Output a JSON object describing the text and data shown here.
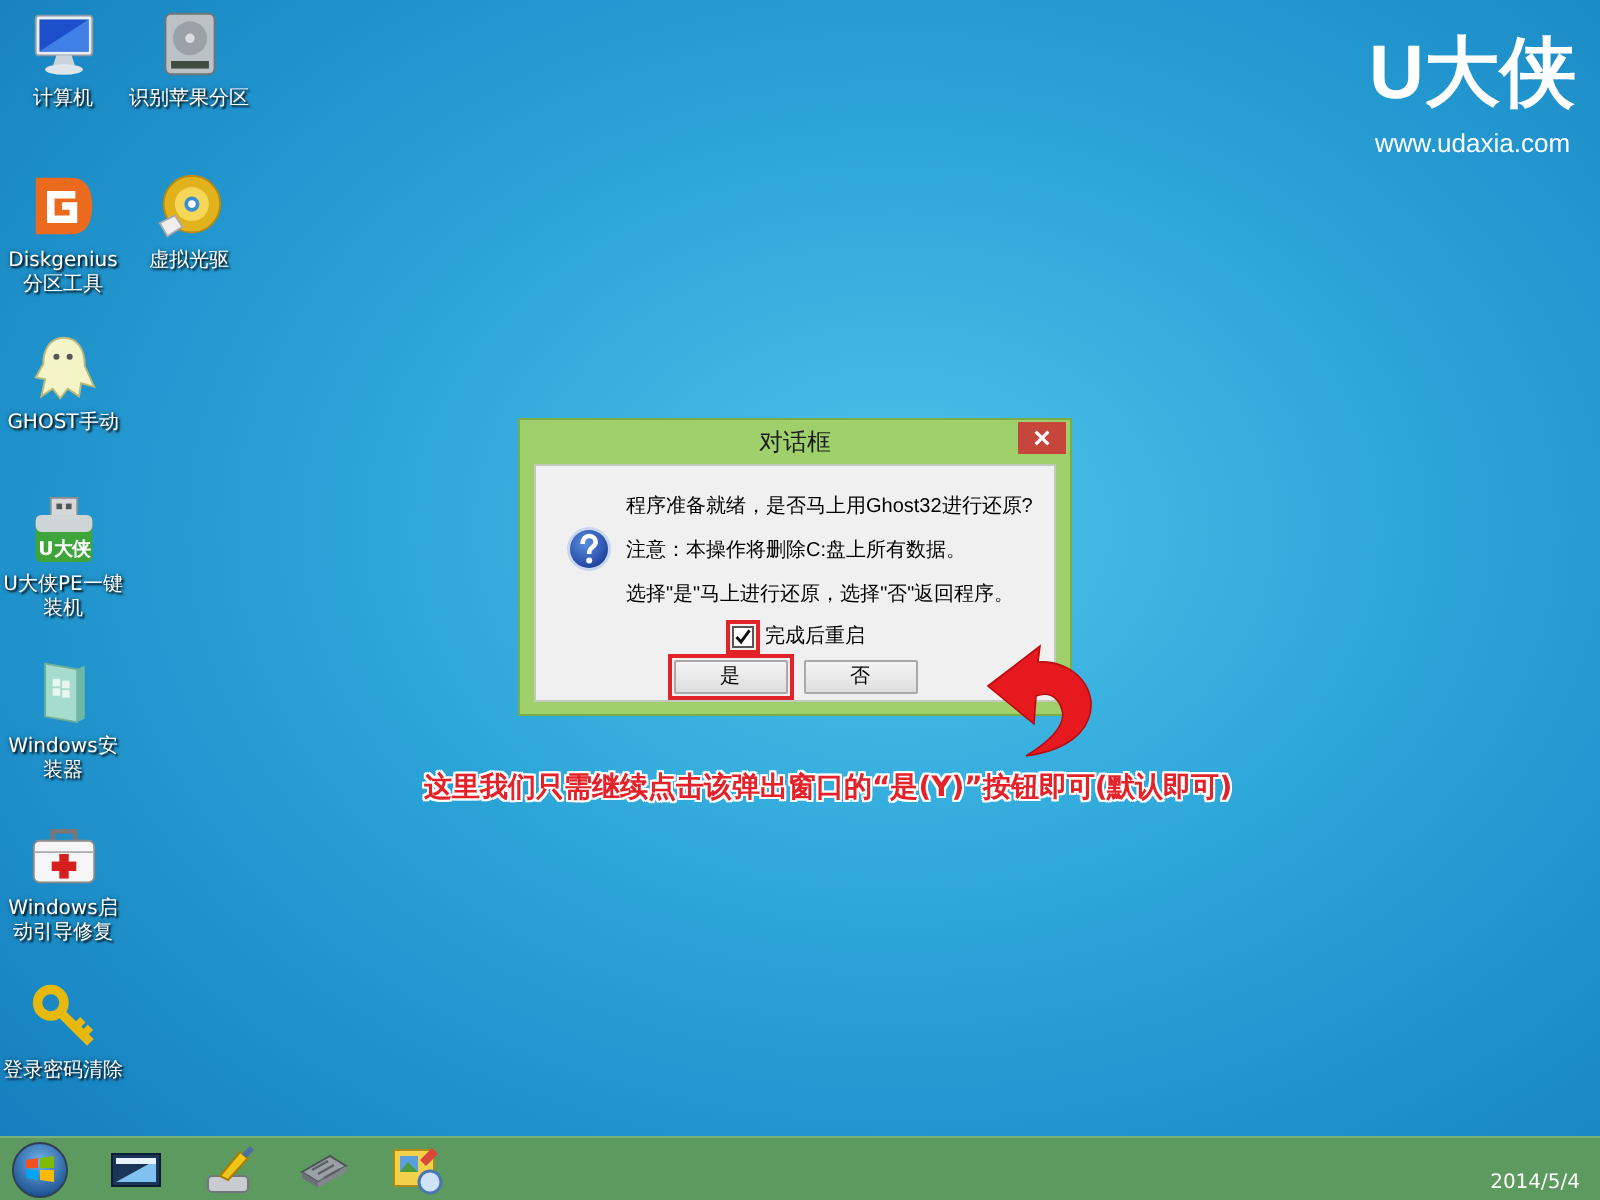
{
  "wallpaper": {
    "logo": "U大侠",
    "url": "www.udaxia.com"
  },
  "desktop_icons": [
    {
      "kind": "computer",
      "label": "计算机"
    },
    {
      "kind": "diskgenius",
      "label": "Diskgenius分区工具"
    },
    {
      "kind": "ghost",
      "label": "GHOST手动"
    },
    {
      "kind": "usb",
      "badge": "U大侠",
      "label": "U大侠PE一键装机"
    },
    {
      "kind": "installer",
      "label": "Windows安装器"
    },
    {
      "kind": "toolkit",
      "label": "Windows启动引导修复"
    },
    {
      "kind": "key",
      "label": "登录密码清除"
    },
    {
      "kind": "drive",
      "label": "识别苹果分区"
    },
    {
      "kind": "disc",
      "label": "虚拟光驱"
    }
  ],
  "dialog": {
    "title": "对话框",
    "lines": [
      "程序准备就绪，是否马上用Ghost32进行还原?",
      "注意：本操作将删除C:盘上所有数据。",
      "选择\"是\"马上进行还原，选择\"否\"返回程序。"
    ],
    "checkbox": {
      "label": "完成后重启",
      "checked": true,
      "highlighted": true
    },
    "buttons": [
      {
        "label": "是",
        "highlighted": true
      },
      {
        "label": "否",
        "highlighted": false
      }
    ]
  },
  "annotation": {
    "text": "这里我们只需继续点击该弹出窗口的“是(Y)”按钮即可(默认即可)"
  },
  "taskbar": {
    "pinned": [
      {
        "kind": "monitor"
      },
      {
        "kind": "brush"
      },
      {
        "kind": "chip"
      },
      {
        "kind": "pictures"
      }
    ],
    "clock": "2014/5/4"
  }
}
